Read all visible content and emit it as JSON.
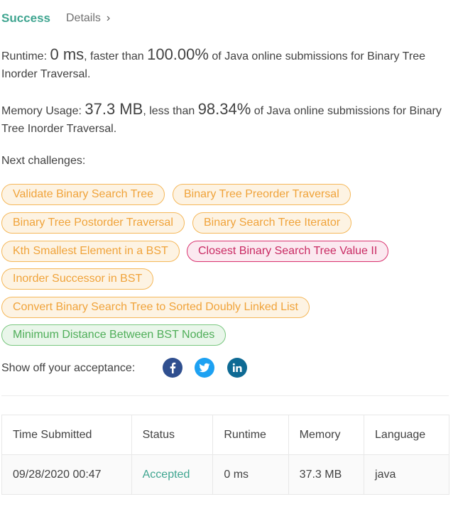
{
  "header": {
    "status": "Success",
    "details_label": "Details",
    "chevron": "›"
  },
  "runtime": {
    "label": "Runtime: ",
    "value": "0 ms",
    "faster_than": ", faster than ",
    "percent": "100.00%",
    "suffix": " of Java online submissions for Binary Tree Inorder Traversal."
  },
  "memory": {
    "label": "Memory Usage: ",
    "value": "37.3 MB",
    "less_than": ", less than ",
    "percent": "98.34%",
    "suffix": " of Java online submissions for Binary Tree Inorder Traversal."
  },
  "next": {
    "label": "Next challenges:",
    "challenges": [
      {
        "label": "Validate Binary Search Tree",
        "difficulty": "orange"
      },
      {
        "label": "Binary Tree Preorder Traversal",
        "difficulty": "orange"
      },
      {
        "label": "Binary Tree Postorder Traversal",
        "difficulty": "orange"
      },
      {
        "label": "Binary Search Tree Iterator",
        "difficulty": "orange"
      },
      {
        "label": "Kth Smallest Element in a BST",
        "difficulty": "orange"
      },
      {
        "label": "Closest Binary Search Tree Value II",
        "difficulty": "pink"
      },
      {
        "label": "Inorder Successor in BST",
        "difficulty": "orange"
      },
      {
        "label": "Convert Binary Search Tree to Sorted Doubly Linked List",
        "difficulty": "orange"
      },
      {
        "label": "Minimum Distance Between BST Nodes",
        "difficulty": "green"
      }
    ]
  },
  "share": {
    "label": "Show off your acceptance:",
    "icons": [
      "facebook-icon",
      "twitter-icon",
      "linkedin-icon"
    ]
  },
  "submissions": {
    "headers": [
      "Time Submitted",
      "Status",
      "Runtime",
      "Memory",
      "Language"
    ],
    "rows": [
      [
        "09/28/2020 00:47",
        "Accepted",
        "0 ms",
        "37.3 MB",
        "java"
      ]
    ]
  },
  "colors": {
    "accent": "#3fa590",
    "medium_pill": "#f0a33a",
    "hard_pill": "#c92a63",
    "easy_pill": "#4fae59"
  }
}
